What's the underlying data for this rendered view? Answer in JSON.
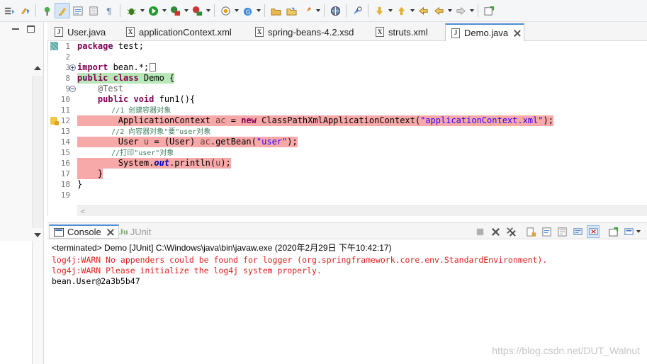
{
  "toolbar": {
    "icons": [
      "toggle-view-icon",
      "mark-occurrences-icon",
      "pin-icon",
      "highlight-icon",
      "breadcrumb-icon",
      "block-selection-icon",
      "whitespace-icon",
      "debug-icon",
      "run-icon",
      "coverage-icon",
      "external-tools-icon",
      "new-server-icon",
      "new-java-class-icon",
      "open-type-icon",
      "open-folder-icon",
      "launch-icon",
      "web-browser-icon",
      "search-icon",
      "next-annotation-icon",
      "prev-annotation-icon",
      "last-edit-icon",
      "back-icon",
      "forward-icon",
      "perspective-icon"
    ],
    "colors": {
      "debug": "#3a7d1a",
      "run": "#1f9a2b",
      "accent": "#4f8cd3"
    }
  },
  "editor_tabs": [
    {
      "label": "User.java",
      "icon": "java-file-icon",
      "glyph": "J"
    },
    {
      "label": "applicationContext.xml",
      "icon": "xml-file-icon",
      "glyph": "X"
    },
    {
      "label": "spring-beans-4.2.xsd",
      "icon": "xsd-file-icon",
      "glyph": "X"
    },
    {
      "label": "struts.xml",
      "icon": "xml-file-icon",
      "glyph": "X"
    },
    {
      "label": "Demo.java",
      "icon": "java-file-icon",
      "glyph": "J",
      "active": true
    }
  ],
  "editor": {
    "line_numbers": [
      "1",
      "2",
      "3",
      "8",
      "9",
      "10",
      "11",
      "12",
      "13",
      "14",
      "15",
      "16",
      "17",
      "18",
      "19"
    ],
    "code": {
      "l1_kw": "package",
      "l1_rest": " test;",
      "l3_kw": "import",
      "l3_rest": " bean.*;",
      "l8_kw": "public class",
      "l8_rest": " Demo {",
      "l9": "    @Test",
      "l10_kw": "    public void",
      "l10_rest": " fun1(){",
      "l11": "        //1 创建容器对象",
      "l12_a": "        ApplicationContext ",
      "l12_var": "ac",
      "l12_b": " = ",
      "l12_kw": "new",
      "l12_c": " ClassPathXmlApplicationContext(",
      "l12_str": "\"applicationContext.xml\"",
      "l12_d": ");",
      "l13": "        //2 向容器对象\"要\"user对象",
      "l14_a": "        User ",
      "l14_var": "u",
      "l14_b": " = (User) ",
      "l14_var2": "ac",
      "l14_c": ".getBean(",
      "l14_str": "\"user\"",
      "l14_d": ");",
      "l15": "        //打印\"user\"对象",
      "l16_a": "        System.",
      "l16_fld": "out",
      "l16_b": ".println(",
      "l16_var": "u",
      "l16_c": ");",
      "l17": "    }",
      "l18": "}"
    }
  },
  "console": {
    "tab_console": "Console",
    "tab_junit": "JUnit",
    "junit_glyph": "Ju",
    "terminated": "<terminated> Demo [JUnit] C:\\Windows\\java\\bin\\javaw.exe (2020年2月29日 下午10:42:17)",
    "lines": [
      {
        "text": "log4j:WARN No appenders could be found for logger (org.springframework.core.env.StandardEnvironment).",
        "type": "err"
      },
      {
        "text": "log4j:WARN Please initialize the log4j system properly.",
        "type": "err"
      },
      {
        "text": "bean.User@2a3b5b47",
        "type": "std"
      }
    ],
    "tool_icons": [
      "terminate-icon",
      "remove-launch-icon",
      "remove-all-icon",
      "scroll-lock-icon",
      "word-wrap-icon",
      "pin-console-icon",
      "display-selected-icon",
      "show-on-output-icon",
      "open-console-icon"
    ]
  },
  "watermark": "https://blog.csdn.net/DUT_Walnut"
}
